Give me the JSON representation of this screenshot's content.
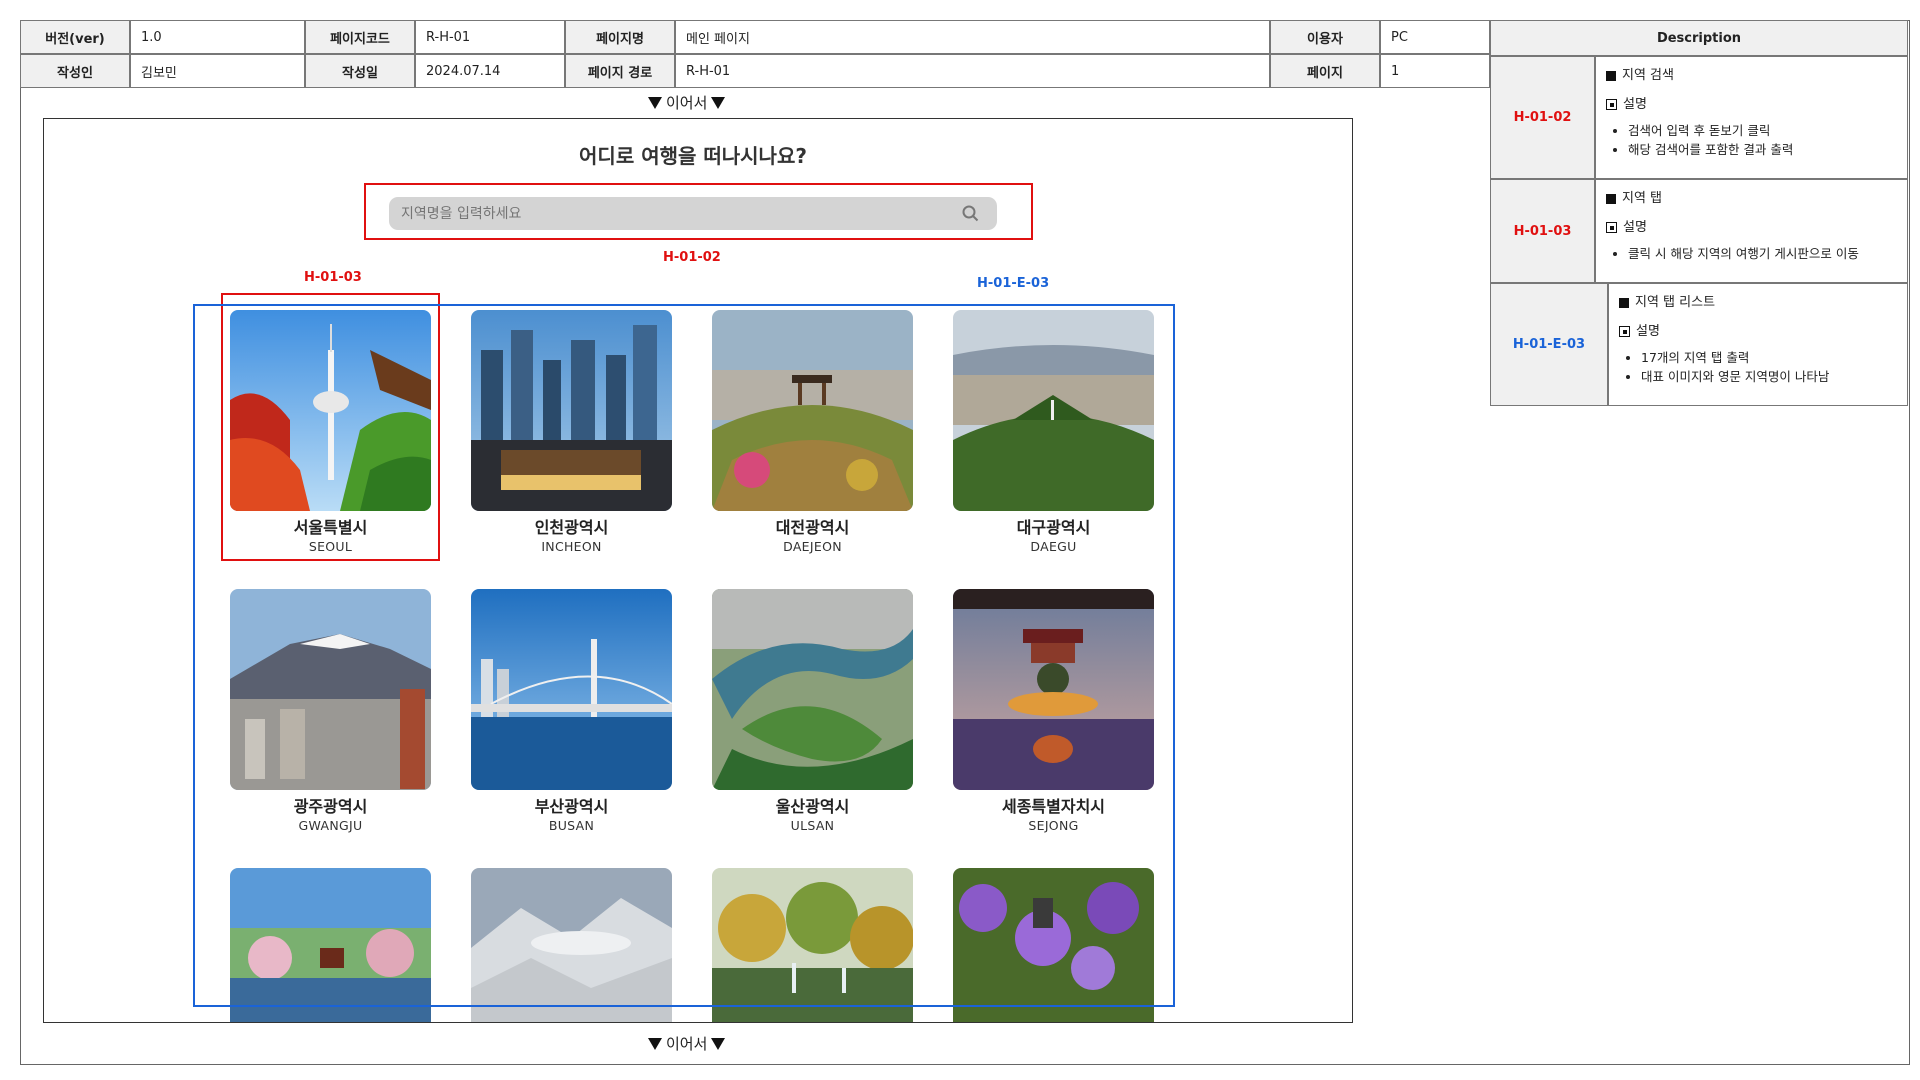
{
  "header": {
    "row1": [
      {
        "label": "버전(ver)",
        "value": "1.0"
      },
      {
        "label": "페이지코드",
        "value": "R-H-01"
      },
      {
        "label": "페이지명",
        "value": "메인 페이지"
      },
      {
        "label": "이용자",
        "value": "PC"
      }
    ],
    "row2": [
      {
        "label": "작성인",
        "value": "김보민"
      },
      {
        "label": "작성일",
        "value": "2024.07.14"
      },
      {
        "label": "페이지 경로",
        "value": "R-H-01"
      },
      {
        "label": "페이지",
        "value": "1"
      }
    ]
  },
  "continue_label": "이어서",
  "wireframe": {
    "heading": "어디로 여행을 떠나시나요?",
    "search": {
      "placeholder": "지역명을 입력하세요",
      "icon": "search-icon"
    },
    "annotations": {
      "search": "H-01-02",
      "tab": "H-01-03",
      "list": "H-01-E-03"
    },
    "regions": [
      {
        "kr": "서울특별시",
        "en": "SEOUL"
      },
      {
        "kr": "인천광역시",
        "en": "INCHEON"
      },
      {
        "kr": "대전광역시",
        "en": "DAEJEON"
      },
      {
        "kr": "대구광역시",
        "en": "DAEGU"
      },
      {
        "kr": "광주광역시",
        "en": "GWANGJU"
      },
      {
        "kr": "부산광역시",
        "en": "BUSAN"
      },
      {
        "kr": "울산광역시",
        "en": "ULSAN"
      },
      {
        "kr": "세종특별자치시",
        "en": "SEJONG"
      },
      {
        "kr": "",
        "en": ""
      },
      {
        "kr": "",
        "en": ""
      },
      {
        "kr": "",
        "en": ""
      },
      {
        "kr": "",
        "en": ""
      }
    ],
    "colors": {
      "annotation_red": "#e01010",
      "annotation_blue": "#1a63d8",
      "search_bg": "#d4d4d4"
    }
  },
  "description": {
    "title": "Description",
    "items": [
      {
        "code": "H-01-02",
        "title": "지역 검색",
        "sub": "설명",
        "bullets": [
          "검색어 입력 후 돋보기 클릭",
          "해당 검색어를 포함한 결과 출력"
        ]
      },
      {
        "code": "H-01-03",
        "title": "지역 탭",
        "sub": "설명",
        "bullets": [
          "클릭 시 해당 지역의 여행기 게시판으로 이동"
        ]
      },
      {
        "code": "H-01-E-03",
        "title": "지역 탭 리스트",
        "sub": "설명",
        "bullets": [
          "17개의 지역 탭 출력",
          "대표 이미지와 영문 지역명이 나타남"
        ]
      }
    ]
  }
}
